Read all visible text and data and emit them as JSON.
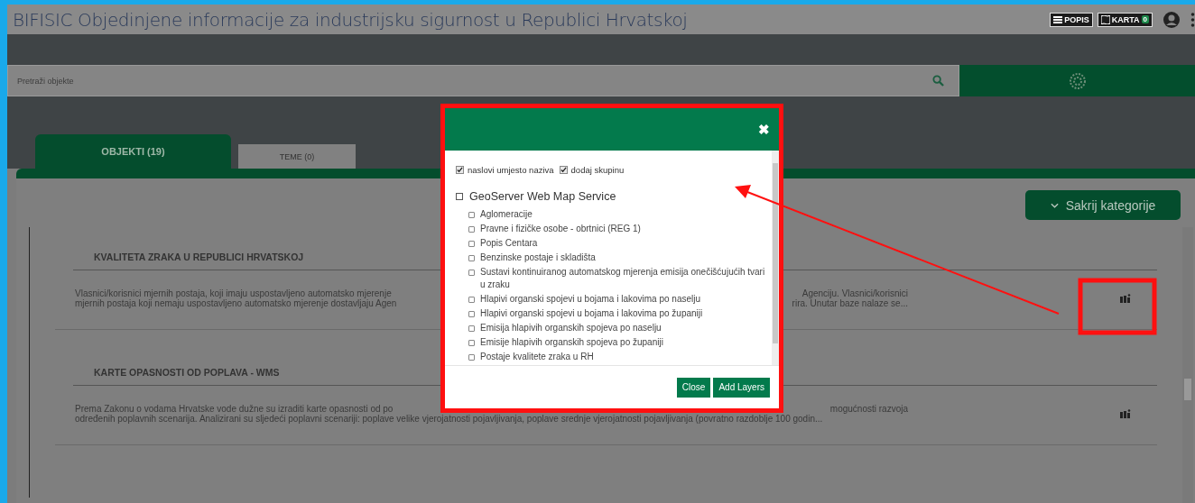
{
  "window": {
    "title": "BIFISIC Objedinjene informacije za industrijsku sigurnost u Republici Hrvatskoj"
  },
  "header_buttons": [
    {
      "kind": "list",
      "label": "POPIS"
    },
    {
      "kind": "map",
      "label": "KARTA",
      "badge": "0"
    }
  ],
  "search": {
    "placeholder": "Pretraži objekte"
  },
  "tabs": [
    {
      "label": "OBJEKTI (19)",
      "selected": true
    },
    {
      "label": "TEME (0)",
      "selected": false
    }
  ],
  "hide_categories_button": "Sakrij kategorije",
  "categories": [
    {
      "title": "KVALITETA ZRAKA U REPUBLICI HRVATSKOJ",
      "lines": [
        {
          "left": "Vlasnici/korisnici mjernih postaja, koji imaju uspostavljeno automatsko mjerenje",
          "right": "Agenciju. Vlasnici/korisnici"
        },
        {
          "left": "mjernih postaja koji nemaju uspostavljeno automatsko mjerenje dostavljaju Agen",
          "right": "rira. Unutar baze nalaze se..."
        }
      ]
    },
    {
      "title": "KARTE OPASNOSTI OD POPLAVA - WMS",
      "lines": [
        {
          "left": "Prema Zakonu o vodama Hrvatske vode dužne su izraditi karte opasnosti od po",
          "right": "mogućnosti razvoja"
        },
        {
          "left": "određenih poplavnih scenarija. Analizirani su sljedeći poplavni scenariji: poplave velike vjerojatnosti pojavljivanja, poplave srednje vjerojatnosti pojavljivanja (povratno razdoblje 100 godin..."
        }
      ]
    }
  ],
  "dialog": {
    "close": "✖",
    "options": [
      {
        "label": "naslovi umjesto naziva",
        "checked": true
      },
      {
        "label": "dodaj skupinu",
        "checked": true
      }
    ],
    "group": {
      "label": "GeoServer Web Map Service",
      "checked": false,
      "children": [
        {
          "label": "Aglomeracije",
          "checked": false
        },
        {
          "label": "Pravne i fizičke osobe - obrtnici (REG 1)",
          "checked": false
        },
        {
          "label": "Popis Centara",
          "checked": false
        },
        {
          "label": "Benzinske postaje i skladišta",
          "checked": false
        },
        {
          "label": "Sustavi kontinuiranog automatskog mjerenja emisija onečišćujućih tvari u zraku",
          "checked": false
        },
        {
          "label": "Hlapivi organski spojevi u bojama i lakovima po naselju",
          "checked": false
        },
        {
          "label": "Hlapivi organski spojevi u bojama i lakovima po županiji",
          "checked": false
        },
        {
          "label": "Emisija hlapivih organskih spojeva po naselju",
          "checked": false
        },
        {
          "label": "Emisije hlapivih organskih spojeva po županiji",
          "checked": false
        },
        {
          "label": "Postaje kvalitete zraka u RH",
          "checked": false
        }
      ]
    },
    "buttons": [
      "Close",
      "Add Layers"
    ]
  }
}
